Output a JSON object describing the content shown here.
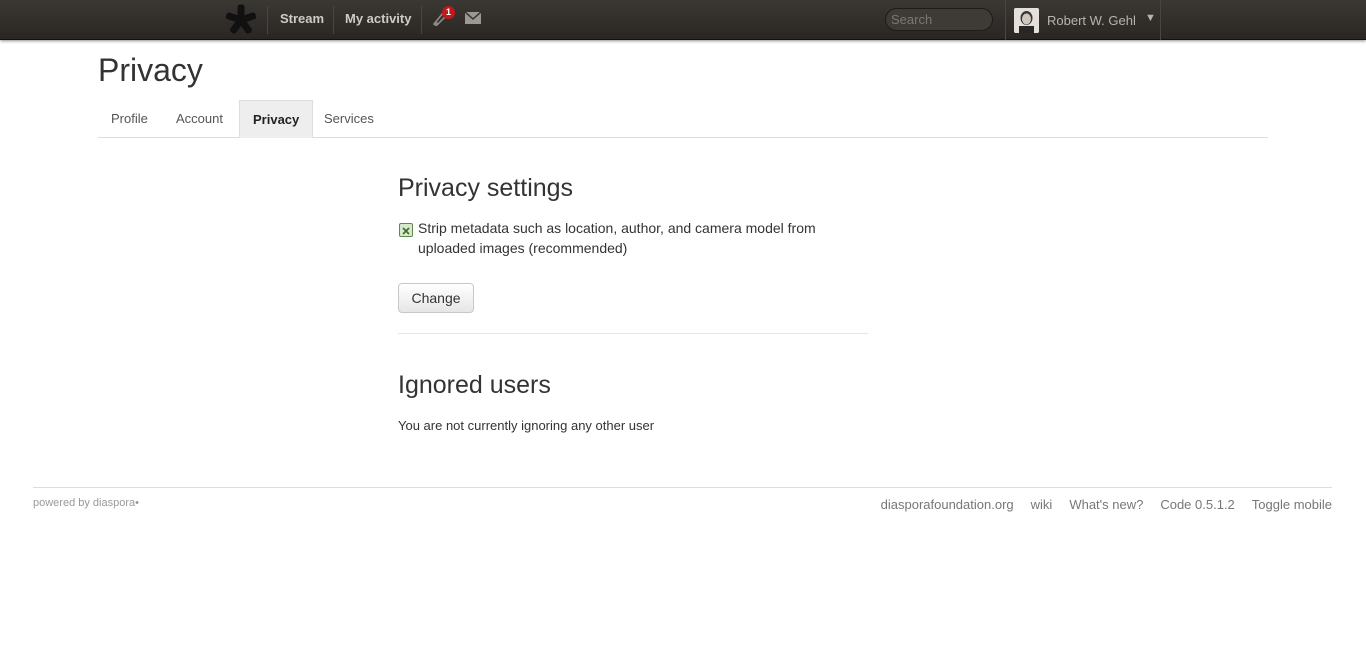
{
  "header": {
    "nav": {
      "stream": "Stream",
      "my_activity": "My activity"
    },
    "notifications": {
      "count": "1",
      "icon": "notifications-icon"
    },
    "messages": {
      "icon": "mail-icon"
    },
    "search": {
      "placeholder": "Search"
    },
    "user": {
      "name": "Robert W. Gehl",
      "caret": "▼"
    }
  },
  "page": {
    "title": "Privacy",
    "tabs": [
      {
        "label": "Profile"
      },
      {
        "label": "Account"
      },
      {
        "label": "Privacy",
        "active": true
      },
      {
        "label": "Services"
      }
    ]
  },
  "privacy_settings": {
    "title": "Privacy settings",
    "strip_metadata": {
      "checked": true,
      "label": "Strip metadata such as location, author, and camera model from uploaded images (recommended)"
    },
    "change_button": "Change"
  },
  "ignored_users": {
    "title": "Ignored users",
    "message": "You are not currently ignoring any other user"
  },
  "footer": {
    "powered_by": "powered by diaspora•",
    "links": [
      "diasporafoundation.org",
      "wiki",
      "What's new?",
      "Code 0.5.1.2",
      "Toggle mobile"
    ]
  },
  "colors": {
    "topbar": "#2f2b28",
    "badge": "#c2181c",
    "checkbox": "#5d8a4a"
  }
}
